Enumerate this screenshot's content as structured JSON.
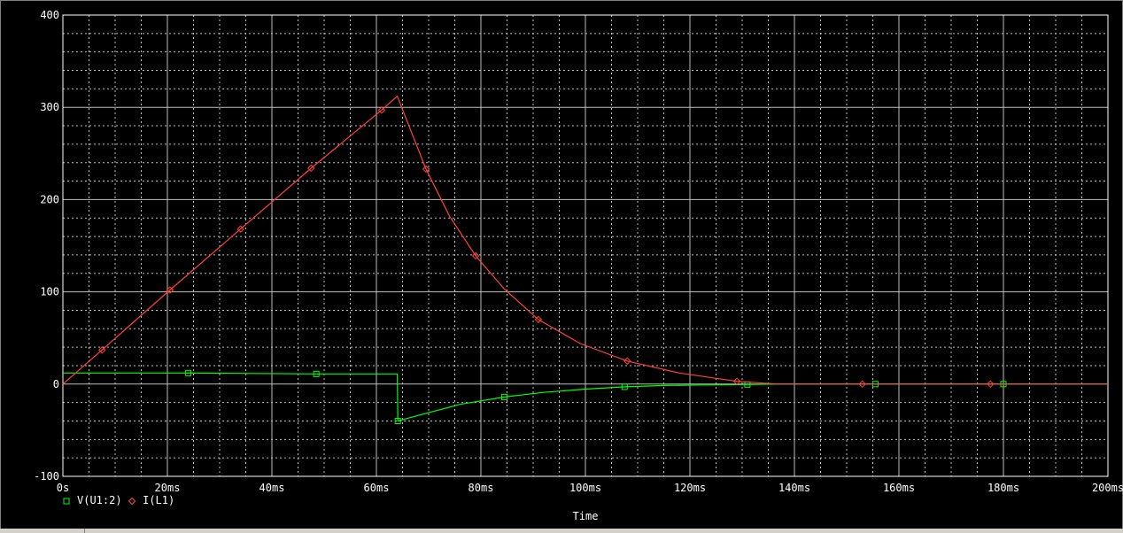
{
  "chart_data": {
    "type": "line",
    "xlabel": "Time",
    "ylabel": "",
    "xlim": [
      0,
      200
    ],
    "ylim": [
      -100,
      400
    ],
    "x_unit": "ms",
    "x_ticks": [
      0,
      20,
      40,
      60,
      80,
      100,
      120,
      140,
      160,
      180,
      200
    ],
    "x_tick_labels": [
      "0s",
      "20ms",
      "40ms",
      "60ms",
      "80ms",
      "100ms",
      "120ms",
      "140ms",
      "160ms",
      "180ms",
      "200ms"
    ],
    "y_ticks": [
      -100,
      0,
      100,
      200,
      300,
      400
    ],
    "y_tick_labels": [
      "-100",
      "0",
      "100",
      "200",
      "300",
      "400"
    ],
    "grid": true,
    "legend_position": "bottom-left",
    "series": [
      {
        "name": "V(U1:2)",
        "color": "#00ff00",
        "marker": "square",
        "points": [
          [
            0,
            12
          ],
          [
            24,
            12
          ],
          [
            48.5,
            11
          ],
          [
            64,
            11
          ],
          [
            64.1,
            -40
          ],
          [
            70,
            -31
          ],
          [
            76,
            -22
          ],
          [
            84.5,
            -14
          ],
          [
            92,
            -9
          ],
          [
            100,
            -5.5
          ],
          [
            107.5,
            -3
          ],
          [
            115,
            -1.5
          ],
          [
            122,
            -1
          ],
          [
            131,
            -0.5
          ],
          [
            137,
            0
          ],
          [
            155.5,
            0
          ],
          [
            180,
            0
          ],
          [
            200,
            0
          ]
        ],
        "marker_x": [
          24,
          48.5,
          64.1,
          84.5,
          107.5,
          131,
          155.5,
          180
        ]
      },
      {
        "name": "I(L1)",
        "color": "#ff4040",
        "marker": "diamond",
        "points": [
          [
            0,
            0
          ],
          [
            7.5,
            37
          ],
          [
            20.5,
            102
          ],
          [
            34,
            168
          ],
          [
            47.5,
            234
          ],
          [
            61,
            297
          ],
          [
            64,
            312
          ],
          [
            69.5,
            233
          ],
          [
            74,
            182
          ],
          [
            79,
            139
          ],
          [
            84.5,
            103
          ],
          [
            91,
            70
          ],
          [
            99,
            44
          ],
          [
            108,
            25
          ],
          [
            118,
            12
          ],
          [
            129,
            3
          ],
          [
            137,
            0
          ],
          [
            153,
            0
          ],
          [
            177.5,
            0
          ],
          [
            200,
            0
          ]
        ],
        "marker_x": [
          7.5,
          20.5,
          34,
          47.5,
          61,
          69.5,
          79,
          91,
          108,
          129,
          153,
          177.5
        ]
      }
    ]
  }
}
